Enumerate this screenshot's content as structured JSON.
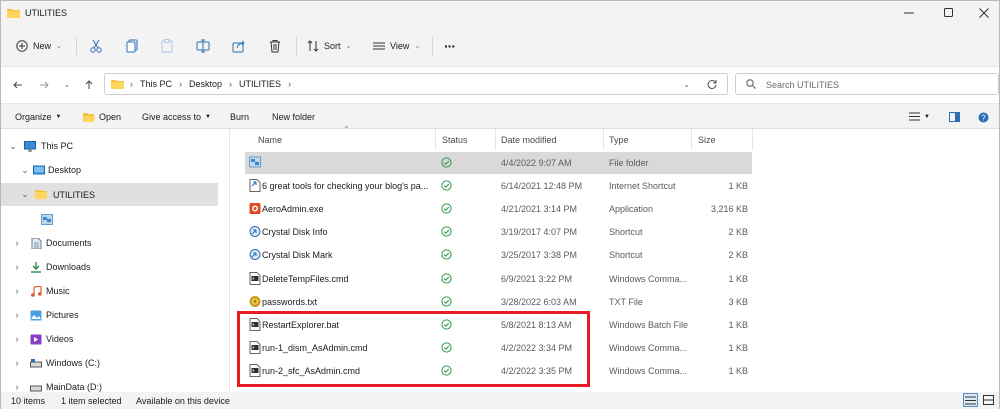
{
  "window": {
    "title": "UTILITIES"
  },
  "toolbar": {
    "new_label": "New",
    "sort_label": "Sort",
    "view_label": "View",
    "more_label": "···"
  },
  "address": {
    "crumbs": [
      "This PC",
      "Desktop",
      "UTILITIES"
    ],
    "search_placeholder": "Search UTILITIES"
  },
  "commands": {
    "organize": "Organize",
    "open": "Open",
    "give_access": "Give access to",
    "burn": "Burn",
    "new_folder": "New folder"
  },
  "nav": {
    "items": [
      {
        "label": "This PC",
        "expander": "⌄",
        "icon": "monitor-icon",
        "selected": false
      },
      {
        "label": "Desktop",
        "expander": "⌄",
        "icon": "desktop-icon",
        "selected": false
      },
      {
        "label": "UTILITIES",
        "expander": "⌄",
        "icon": "folder-icon",
        "selected": true
      },
      {
        "label": "",
        "expander": "",
        "icon": "nested-folder-icon",
        "selected": false
      },
      {
        "label": "Documents",
        "expander": "›",
        "icon": "documents-icon",
        "selected": false
      },
      {
        "label": "Downloads",
        "expander": "›",
        "icon": "downloads-icon",
        "selected": false
      },
      {
        "label": "Music",
        "expander": "›",
        "icon": "music-icon",
        "selected": false
      },
      {
        "label": "Pictures",
        "expander": "›",
        "icon": "pictures-icon",
        "selected": false
      },
      {
        "label": "Videos",
        "expander": "›",
        "icon": "videos-icon",
        "selected": false
      },
      {
        "label": "Windows (C:)",
        "expander": "›",
        "icon": "drive-icon",
        "selected": false
      },
      {
        "label": "MainData (D:)",
        "expander": "›",
        "icon": "drive-icon",
        "selected": false
      }
    ]
  },
  "columns": {
    "name": "Name",
    "status": "Status",
    "date": "Date modified",
    "type": "Type",
    "size": "Size"
  },
  "files": [
    {
      "name": "",
      "date": "4/4/2022 9:07 AM",
      "type": "File folder",
      "size": "",
      "icon": "folder-shortcut-icon",
      "selected": true
    },
    {
      "name": "6 great tools for checking your blog's pa...",
      "date": "6/14/2021 12:48 PM",
      "type": "Internet Shortcut",
      "size": "1 KB",
      "icon": "internet-shortcut-icon",
      "selected": false
    },
    {
      "name": "AeroAdmin.exe",
      "date": "4/21/2021 3:14 PM",
      "type": "Application",
      "size": "3,216 KB",
      "icon": "app-icon",
      "selected": false
    },
    {
      "name": "Crystal Disk Info",
      "date": "3/19/2017 4:07 PM",
      "type": "Shortcut",
      "size": "2 KB",
      "icon": "shortcut-icon",
      "selected": false
    },
    {
      "name": "Crystal Disk Mark",
      "date": "3/25/2017 3:38 PM",
      "type": "Shortcut",
      "size": "2 KB",
      "icon": "shortcut-icon",
      "selected": false
    },
    {
      "name": "DeleteTempFiles.cmd",
      "date": "6/9/2021 3:22 PM",
      "type": "Windows Comma...",
      "size": "1 KB",
      "icon": "cmd-file-icon",
      "selected": false
    },
    {
      "name": "passwords.txt",
      "date": "3/28/2022 6:03 AM",
      "type": "TXT File",
      "size": "3 KB",
      "icon": "txt-file-icon",
      "selected": false
    },
    {
      "name": "RestartExplorer.bat",
      "date": "5/8/2021 8:13 AM",
      "type": "Windows Batch File",
      "size": "1 KB",
      "icon": "cmd-file-icon",
      "selected": false
    },
    {
      "name": "run-1_dism_AsAdmin.cmd",
      "date": "4/2/2022 3:34 PM",
      "type": "Windows Comma...",
      "size": "1 KB",
      "icon": "cmd-file-icon",
      "selected": false
    },
    {
      "name": "run-2_sfc_AsAdmin.cmd",
      "date": "4/2/2022 3:35 PM",
      "type": "Windows Comma...",
      "size": "1 KB",
      "icon": "cmd-file-icon",
      "selected": false
    }
  ],
  "statusbar": {
    "count": "10 items",
    "selected": "1 item selected",
    "availability": "Available on this device"
  },
  "colors": {
    "highlight": "#e51c23",
    "status_ok": "#2e9a4a",
    "folder": "#f6c13c",
    "selection": "#d9d9d9"
  }
}
